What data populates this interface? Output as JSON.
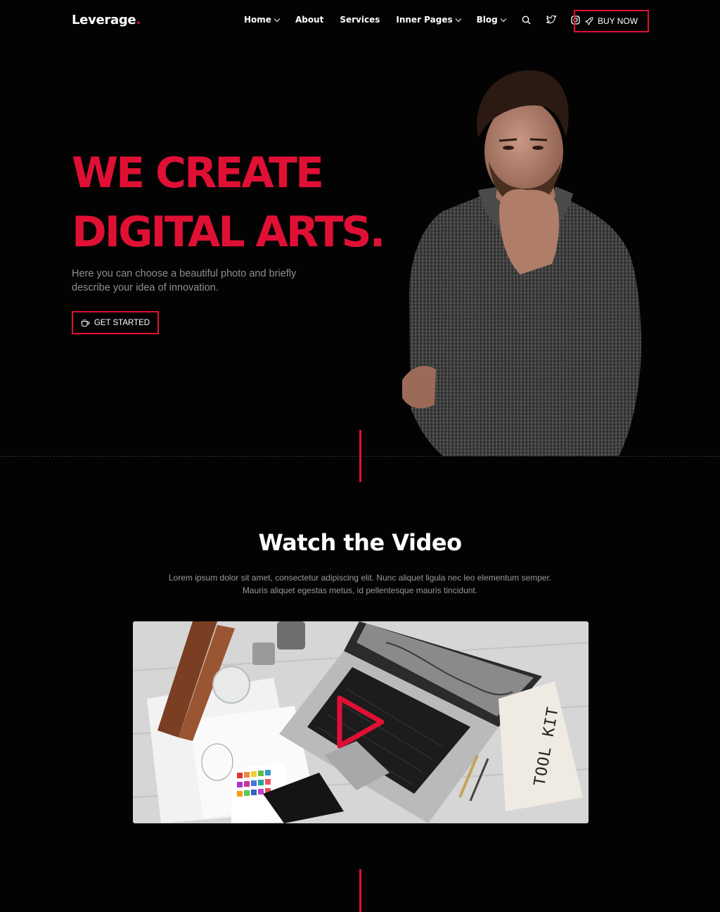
{
  "header": {
    "logo_text": "Leverage",
    "logo_dot": ".",
    "nav": {
      "home": "Home",
      "about": "About",
      "services": "Services",
      "inner_pages": "Inner Pages",
      "blog": "Blog"
    },
    "buy_label": "BUY NOW"
  },
  "hero": {
    "title_line1": "WE CREATE",
    "title_line2": "DIGITAL ARTS.",
    "description": "Here you can choose a beautiful photo and briefly describe your idea of innovation.",
    "cta_label": "GET STARTED"
  },
  "video": {
    "title": "Watch the Video",
    "description": "Lorem ipsum dolor sit amet, consectetur adipiscing elit. Nunc aliquet ligula nec leo elementum semper. Mauris aliquet egestas metus, id pellentesque mauris tincidunt.",
    "pouch_text": "TOOL KIT"
  },
  "colors": {
    "accent": "#e01035",
    "background": "#030303",
    "text_muted": "#8f8f8f"
  },
  "icons": [
    "search-icon",
    "twitter-icon",
    "instagram-icon",
    "rocket-icon",
    "coffee-icon",
    "play-icon",
    "chevron-down-icon"
  ]
}
